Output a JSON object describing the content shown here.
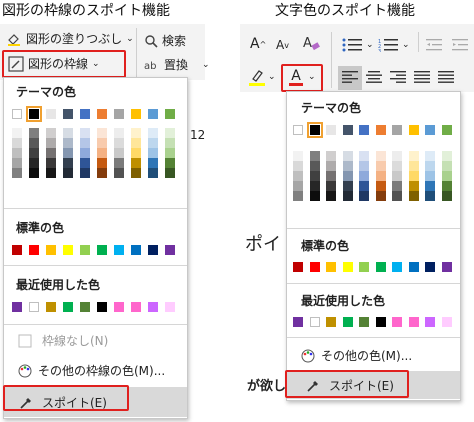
{
  "left": {
    "title": "図形の枠線のスポイト機能",
    "ribbon": {
      "fill_label": "図形の塗りつぶし",
      "outline_label": "図形の枠線",
      "search_label": "検索",
      "replace_label": "置換"
    },
    "theme_colors_header": "テーマの色",
    "standard_colors_header": "標準の色",
    "recent_colors_header": "最近使用した色",
    "no_outline_label": "枠線なし(N)",
    "more_colors_label": "その他の枠線の色(M)...",
    "eyedropper_label": "スポイト(E)",
    "ruler_number": "12"
  },
  "right": {
    "title": "文字色のスポイト機能",
    "ribbon": {
      "font_color_label": "A"
    },
    "theme_colors_header": "テーマの色",
    "standard_colors_header": "標準の色",
    "recent_colors_header": "最近使用した色",
    "more_colors_label": "その他の色(M)...",
    "eyedropper_label": "スポイト(E)",
    "doc_text_1": "ポイ",
    "doc_text_2": "が欲し"
  },
  "colors": {
    "highlight_red": "#e0201e",
    "theme_top": [
      "#ffffff",
      "#000000",
      "#e7e6e6",
      "#44546a",
      "#4472c4",
      "#ed7d31",
      "#a5a5a5",
      "#ffc000",
      "#5b9bd5",
      "#70ad47"
    ],
    "theme_shades": [
      [
        "#f2f2f2",
        "#d9d9d9",
        "#bfbfbf",
        "#a6a6a6",
        "#808080"
      ],
      [
        "#7f7f7f",
        "#595959",
        "#404040",
        "#262626",
        "#0d0d0d"
      ],
      [
        "#d0cece",
        "#aeabab",
        "#757171",
        "#3a3838",
        "#171616"
      ],
      [
        "#d6dce4",
        "#adb9ca",
        "#8496b0",
        "#333f4f",
        "#222a35"
      ],
      [
        "#d9e1f2",
        "#b4c6e7",
        "#8ea9db",
        "#2f5597",
        "#1f3864"
      ],
      [
        "#fbe5d6",
        "#f8cbad",
        "#f4b183",
        "#c55a11",
        "#843c0c"
      ],
      [
        "#ededed",
        "#dbdbdb",
        "#c9c9c9",
        "#7b7b7b",
        "#525252"
      ],
      [
        "#fff2cc",
        "#ffe699",
        "#ffd966",
        "#bf8f00",
        "#7f6000"
      ],
      [
        "#deebf7",
        "#bdd7ee",
        "#9dc3e6",
        "#2e75b6",
        "#1f4e79"
      ],
      [
        "#e2f0d9",
        "#c5e0b4",
        "#a9d18e",
        "#548235",
        "#385723"
      ]
    ],
    "standard": [
      "#c00000",
      "#ff0000",
      "#ffc000",
      "#ffff00",
      "#92d050",
      "#00b050",
      "#00b0f0",
      "#0070c0",
      "#002060",
      "#7030a0"
    ],
    "recent_left": [
      "#7030a0",
      "#ffffff",
      "#bf9000",
      "#00b050",
      "#548235",
      "#000000",
      "#ff66cc",
      "#ff66cc",
      "#cc66ff",
      "#ffccff"
    ],
    "recent_right": [
      "#7030a0",
      "#ffffff",
      "#bf9000",
      "#00b050",
      "#548235",
      "#000000",
      "#ff66cc",
      "#ff66cc",
      "#cc66ff",
      "#ffccff"
    ]
  }
}
